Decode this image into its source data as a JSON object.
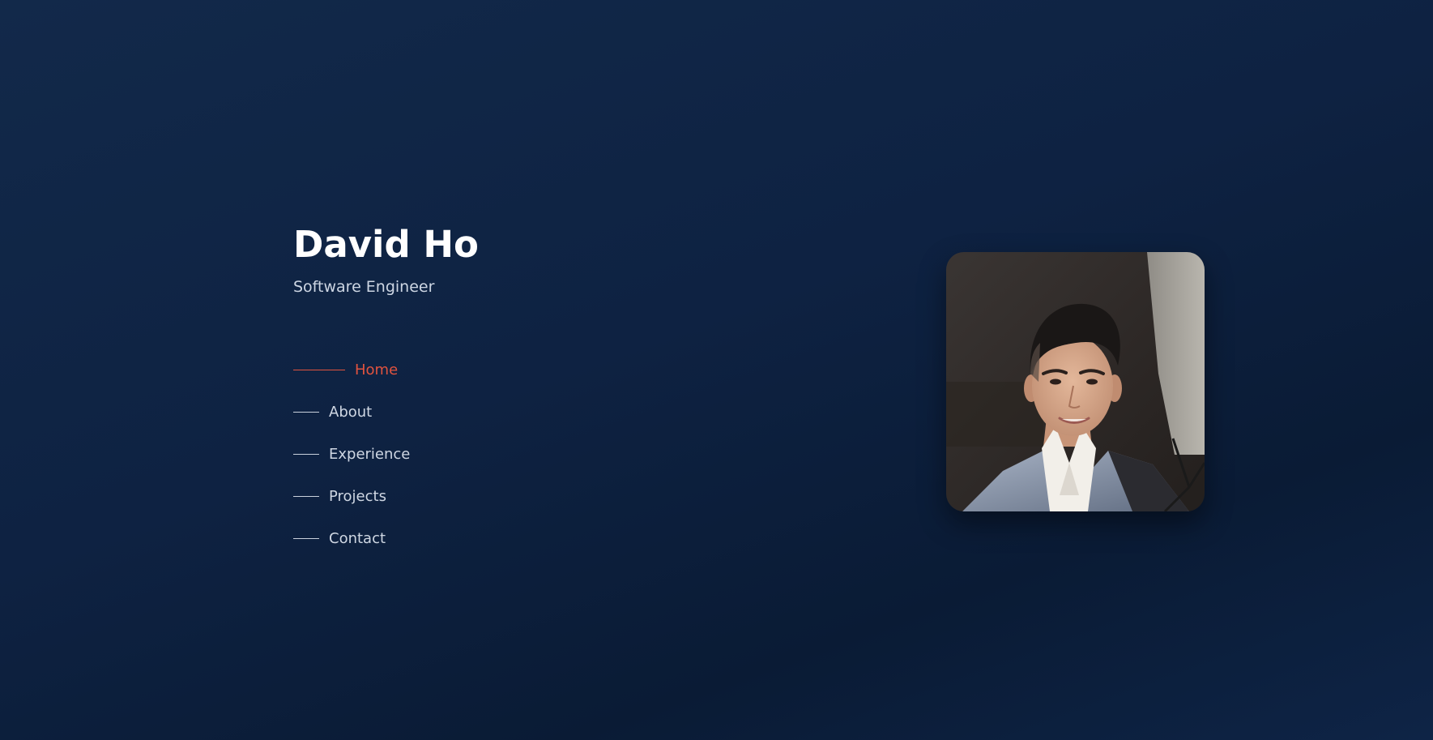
{
  "hero": {
    "name": "David Ho",
    "role": "Software Engineer"
  },
  "nav": {
    "items": [
      {
        "label": "Home",
        "active": true
      },
      {
        "label": "About",
        "active": false
      },
      {
        "label": "Experience",
        "active": false
      },
      {
        "label": "Projects",
        "active": false
      },
      {
        "label": "Contact",
        "active": false
      }
    ]
  },
  "colors": {
    "accent": "#e0533f",
    "background": "#0e2242",
    "text": "#cfd7e3"
  },
  "profile_photo": {
    "alt": "Portrait of David Ho"
  }
}
